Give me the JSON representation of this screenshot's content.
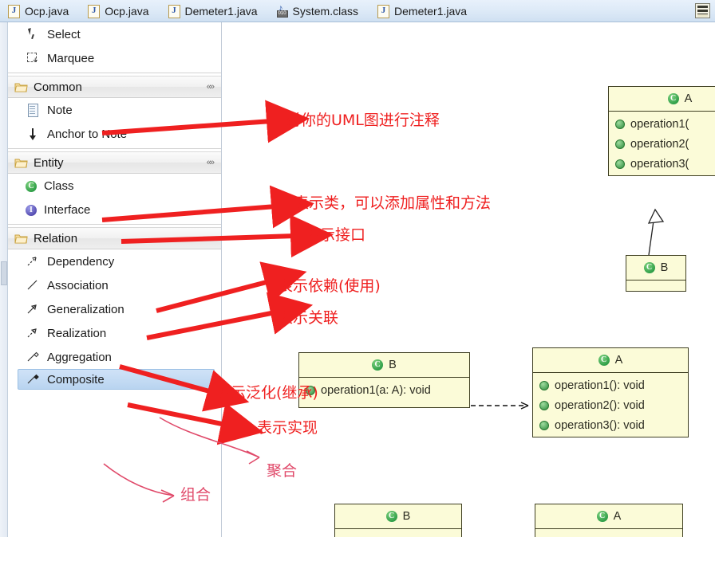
{
  "tabs": [
    {
      "label": "Ocp.java",
      "icon": "java-file-icon"
    },
    {
      "label": "Ocp.java",
      "icon": "java-file-icon"
    },
    {
      "label": "Demeter1.java",
      "icon": "java-file-icon"
    },
    {
      "label": "System.class",
      "icon": "class-file-icon"
    },
    {
      "label": "Demeter1.java",
      "icon": "java-file-icon"
    }
  ],
  "tab_menu": {
    "icon": "tab-list-menu-icon"
  },
  "palette": {
    "tools": [
      {
        "label": "Select",
        "icon": "cursor-icon"
      },
      {
        "label": "Marquee",
        "icon": "marquee-icon"
      }
    ],
    "sections": [
      {
        "title": "Common",
        "icon": "folder-icon",
        "collapse_icon": "collapse-chevrons-icon",
        "items": [
          {
            "label": "Note",
            "icon": "note-icon"
          },
          {
            "label": "Anchor to Note",
            "icon": "anchor-arrow-icon"
          }
        ]
      },
      {
        "title": "Entity",
        "icon": "folder-icon",
        "collapse_icon": "collapse-chevrons-icon",
        "items": [
          {
            "label": "Class",
            "icon": "class-icon"
          },
          {
            "label": "Interface",
            "icon": "interface-icon"
          }
        ]
      },
      {
        "title": "Relation",
        "icon": "folder-icon",
        "collapse_icon": "collapse-chevrons-icon",
        "items": [
          {
            "label": "Dependency",
            "icon": "dependency-arrow-icon"
          },
          {
            "label": "Association",
            "icon": "association-line-icon"
          },
          {
            "label": "Generalization",
            "icon": "generalization-arrow-icon"
          },
          {
            "label": "Realization",
            "icon": "realization-arrow-icon"
          },
          {
            "label": "Aggregation",
            "icon": "aggregation-diamond-icon"
          },
          {
            "label": "Composite",
            "icon": "composite-diamond-icon",
            "selected": true
          }
        ]
      }
    ]
  },
  "annotations": [
    {
      "text": "对你的UML图进行注释",
      "target": "Note"
    },
    {
      "text": "表示类，可以添加属性和方法",
      "target": "Class"
    },
    {
      "text": "表示接口",
      "target": "Interface"
    },
    {
      "text": "表示依赖(使用)",
      "target": "Dependency"
    },
    {
      "text": "表示关联",
      "target": "Association"
    },
    {
      "text": "表示泛化(继承)",
      "target": "Generalization"
    },
    {
      "text": "表示实现",
      "target": "Realization"
    },
    {
      "text": "聚合",
      "target": "Aggregation"
    },
    {
      "text": "组合",
      "target": "Composite"
    }
  ],
  "diagram": {
    "boxes": [
      {
        "name": "A",
        "icon": "class-icon",
        "operations": [
          "operation1(",
          "operation2(",
          "operation3("
        ]
      },
      {
        "name": "B",
        "icon": "class-icon",
        "operations": []
      },
      {
        "name": "B",
        "icon": "class-icon",
        "operations": [
          "operation1(a: A): void"
        ]
      },
      {
        "name": "A",
        "icon": "class-icon",
        "operations": [
          "operation1(): void",
          "operation2(): void",
          "operation3(): void"
        ]
      },
      {
        "name": "B",
        "icon": "class-icon",
        "operations": []
      },
      {
        "name": "A",
        "icon": "class-icon",
        "operations": []
      }
    ]
  },
  "colors": {
    "annotation_red": "#ef2020",
    "annotation_thin": "#e04a6a",
    "uml_fill": "#fbfbd8",
    "uml_border": "#3f3f22",
    "selection_blue": "#b9d4f0"
  }
}
